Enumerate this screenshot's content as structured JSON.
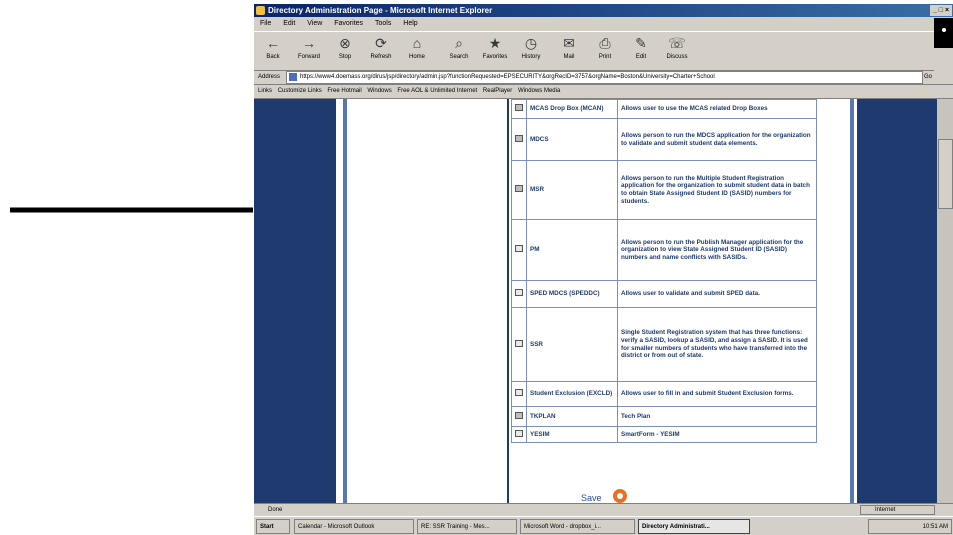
{
  "window": {
    "title": "Directory Administration Page - Microsoft Internet Explorer",
    "controls": "_ □ ×"
  },
  "menu": [
    "File",
    "Edit",
    "View",
    "Favorites",
    "Tools",
    "Help"
  ],
  "toolbar": [
    {
      "label": "Back",
      "icon": "back-arrow-icon",
      "glyph": "←"
    },
    {
      "label": "Forward",
      "icon": "forward-arrow-icon",
      "glyph": "→"
    },
    {
      "label": "Stop",
      "icon": "stop-icon",
      "glyph": "⊗"
    },
    {
      "label": "Refresh",
      "icon": "refresh-icon",
      "glyph": "⟳"
    },
    {
      "label": "Home",
      "icon": "home-icon",
      "glyph": "⌂"
    },
    {
      "label": "Search",
      "icon": "search-icon",
      "glyph": "⌕"
    },
    {
      "label": "Favorites",
      "icon": "favorites-icon",
      "glyph": "★"
    },
    {
      "label": "History",
      "icon": "history-icon",
      "glyph": "◷"
    },
    {
      "label": "Mail",
      "icon": "mail-icon",
      "glyph": "✉"
    },
    {
      "label": "Print",
      "icon": "print-icon",
      "glyph": "⎙"
    },
    {
      "label": "Edit",
      "icon": "edit-icon",
      "glyph": "✎"
    },
    {
      "label": "Discuss",
      "icon": "discuss-icon",
      "glyph": "☏"
    }
  ],
  "address": {
    "label": "Address",
    "url": "https://www4.doemass.org/dirus/jsp/directory/admin.jsp?functionRequested=EPSECURITY&orgRecID=3757&orgName=Boston&University=Charter+School",
    "go_label": "Go"
  },
  "links": {
    "label": "Links",
    "items": [
      "Customize Links",
      "Free Hotmail",
      "Windows",
      "Free AOL & Unlimited Internet",
      "RealPlayer",
      "Windows Media"
    ]
  },
  "roles": [
    {
      "name": "MCAS Drop Box (MCAN)",
      "desc": "Allows user to use the MCAS related Drop Boxes",
      "checked": true
    },
    {
      "name": "MDCS",
      "desc": "Allows person to run the MDCS application for the organization to validate and submit student data elements.",
      "checked": true
    },
    {
      "name": "MSR",
      "desc": "Allows person to run the Multiple Student Registration application for the organization to submit student data in batch to obtain State Assigned Student ID (SASID) numbers for students.",
      "checked": true
    },
    {
      "name": "PM",
      "desc": "Allows person to run the Publish Manager application for the organization to view State Assigned Student ID (SASID) numbers and name conflicts with SASIDs.",
      "checked": false
    },
    {
      "name": "SPED MDCS (SPEDDC)",
      "desc": "Allows user to validate and submit SPED data.",
      "checked": false
    },
    {
      "name": "SSR",
      "desc": "Single Student Registration system that has three functions: verify a SASID, lookup a SASID, and assign a SASID. It is used for smaller numbers of students who have transferred into the district or from out of state.",
      "checked": false
    },
    {
      "name": "Student Exclusion (EXCLD)",
      "desc": "Allows user to fill in and submit Student Exclusion forms.",
      "checked": false
    },
    {
      "name": "TKPLAN",
      "desc": "Tech Plan",
      "checked": true
    },
    {
      "name": "YESIM",
      "desc": "SmartForm - YESIM",
      "checked": false
    }
  ],
  "save_label": "Save",
  "status": {
    "text": "Done",
    "zone": "Internet"
  },
  "taskbar": {
    "start": "Start",
    "tasks": [
      "Calendar - Microsoft Outlook",
      "RE: SSR Training - Mes...",
      "Microsoft Word - dropbox_i...",
      "Directory Administrati..."
    ],
    "clock": "10:51 AM"
  }
}
